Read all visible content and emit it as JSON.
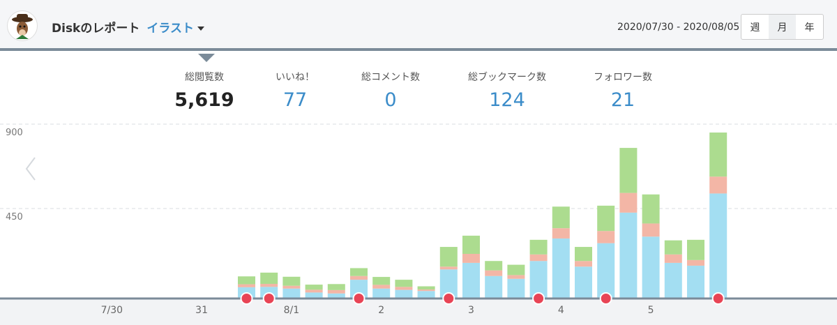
{
  "header": {
    "title": "Diskのレポート",
    "category": "イラスト",
    "date_range": "2020/07/30 - 2020/08/05",
    "periods": [
      "週",
      "月",
      "年"
    ]
  },
  "stats": [
    {
      "label": "総閲覧数",
      "value": "5,619"
    },
    {
      "label": "いいね！",
      "value": "77"
    },
    {
      "label": "総コメント数",
      "value": "0"
    },
    {
      "label": "総ブックマーク数",
      "value": "124"
    },
    {
      "label": "フォロワー数",
      "value": "21"
    }
  ],
  "colors": {
    "views": "#a3def2",
    "likes": "#f3b6a6",
    "bookmarks": "#acdc8f",
    "marker": "#e84455",
    "accent": "#3b8cc9",
    "axis": "#7b8b99"
  },
  "chart_data": {
    "type": "bar",
    "stacked": true,
    "y_ticks": [
      450,
      900
    ],
    "ylim": [
      0,
      900
    ],
    "x_labels": [
      {
        "label": "7/30",
        "bar": -6
      },
      {
        "label": "31",
        "bar": -2
      },
      {
        "label": "8/1",
        "bar": 2
      },
      {
        "label": "2",
        "bar": 6
      },
      {
        "label": "3",
        "bar": 10
      },
      {
        "label": "4",
        "bar": 14
      },
      {
        "label": "5",
        "bar": 18
      }
    ],
    "bars": [
      {
        "views": 60,
        "likes": 16,
        "bookmarks": 42
      },
      {
        "views": 62,
        "likes": 16,
        "bookmarks": 60
      },
      {
        "views": 53,
        "likes": 15,
        "bookmarks": 48
      },
      {
        "views": 32,
        "likes": 15,
        "bookmarks": 27
      },
      {
        "views": 27,
        "likes": 18,
        "bookmarks": 32
      },
      {
        "views": 100,
        "likes": 20,
        "bookmarks": 42
      },
      {
        "views": 53,
        "likes": 20,
        "bookmarks": 42
      },
      {
        "views": 46,
        "likes": 16,
        "bookmarks": 38
      },
      {
        "views": 40,
        "likes": 8,
        "bookmarks": 17
      },
      {
        "views": 155,
        "likes": 15,
        "bookmarks": 105
      },
      {
        "views": 190,
        "likes": 48,
        "bookmarks": 97
      },
      {
        "views": 120,
        "likes": 30,
        "bookmarks": 50
      },
      {
        "views": 105,
        "likes": 20,
        "bookmarks": 55
      },
      {
        "views": 200,
        "likes": 35,
        "bookmarks": 78
      },
      {
        "views": 320,
        "likes": 55,
        "bookmarks": 115
      },
      {
        "views": 170,
        "likes": 30,
        "bookmarks": 75
      },
      {
        "views": 295,
        "likes": 65,
        "bookmarks": 135
      },
      {
        "views": 458,
        "likes": 105,
        "bookmarks": 240
      },
      {
        "views": 330,
        "likes": 70,
        "bookmarks": 155
      },
      {
        "views": 190,
        "likes": 45,
        "bookmarks": 75
      },
      {
        "views": 175,
        "likes": 30,
        "bookmarks": 108
      },
      {
        "views": 560,
        "likes": 90,
        "bookmarks": 235
      }
    ],
    "markers_at_bars": [
      0,
      1,
      5,
      9,
      13,
      16,
      21
    ]
  }
}
